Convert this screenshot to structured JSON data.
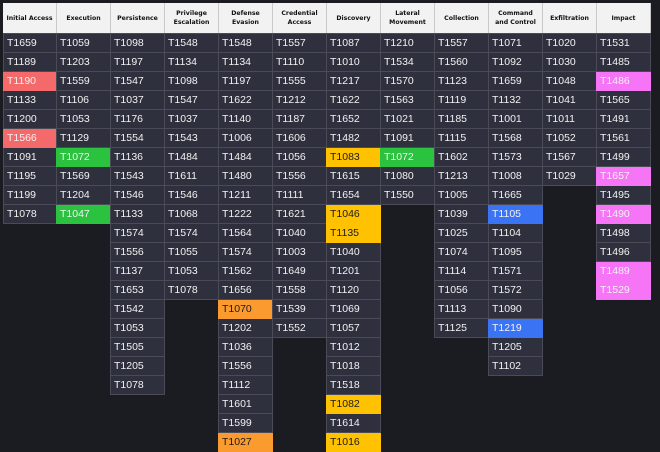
{
  "colors": {
    "red": "#f46a6a",
    "green": "#2ac23e",
    "orange": "#fb9a2e",
    "yellow": "#ffc200",
    "blue": "#3a74f5",
    "pink": "#f675f6"
  },
  "tactics": [
    {
      "name": "Initial Access",
      "techniques": [
        {
          "id": "T1659"
        },
        {
          "id": "T1189"
        },
        {
          "id": "T1190",
          "color": "red"
        },
        {
          "id": "T1133"
        },
        {
          "id": "T1200"
        },
        {
          "id": "T1566",
          "color": "red"
        },
        {
          "id": "T1091"
        },
        {
          "id": "T1195"
        },
        {
          "id": "T1199"
        },
        {
          "id": "T1078"
        }
      ]
    },
    {
      "name": "Execution",
      "techniques": [
        {
          "id": "T1059"
        },
        {
          "id": "T1203"
        },
        {
          "id": "T1559"
        },
        {
          "id": "T1106"
        },
        {
          "id": "T1053"
        },
        {
          "id": "T1129"
        },
        {
          "id": "T1072",
          "color": "green"
        },
        {
          "id": "T1569"
        },
        {
          "id": "T1204"
        },
        {
          "id": "T1047",
          "color": "green"
        }
      ]
    },
    {
      "name": "Persistence",
      "techniques": [
        {
          "id": "T1098"
        },
        {
          "id": "T1197"
        },
        {
          "id": "T1547"
        },
        {
          "id": "T1037"
        },
        {
          "id": "T1176"
        },
        {
          "id": "T1554"
        },
        {
          "id": "T1136"
        },
        {
          "id": "T1543"
        },
        {
          "id": "T1546"
        },
        {
          "id": "T1133"
        },
        {
          "id": "T1574"
        },
        {
          "id": "T1556"
        },
        {
          "id": "T1137"
        },
        {
          "id": "T1653"
        },
        {
          "id": "T1542"
        },
        {
          "id": "T1053"
        },
        {
          "id": "T1505"
        },
        {
          "id": "T1205"
        },
        {
          "id": "T1078"
        }
      ]
    },
    {
      "name": "Privilege Escalation",
      "techniques": [
        {
          "id": "T1548"
        },
        {
          "id": "T1134"
        },
        {
          "id": "T1098"
        },
        {
          "id": "T1547"
        },
        {
          "id": "T1037"
        },
        {
          "id": "T1543"
        },
        {
          "id": "T1484"
        },
        {
          "id": "T1611"
        },
        {
          "id": "T1546"
        },
        {
          "id": "T1068"
        },
        {
          "id": "T1574"
        },
        {
          "id": "T1055"
        },
        {
          "id": "T1053"
        },
        {
          "id": "T1078"
        }
      ]
    },
    {
      "name": "Defense Evasion",
      "techniques": [
        {
          "id": "T1548"
        },
        {
          "id": "T1134"
        },
        {
          "id": "T1197"
        },
        {
          "id": "T1622"
        },
        {
          "id": "T1140"
        },
        {
          "id": "T1006"
        },
        {
          "id": "T1484"
        },
        {
          "id": "T1480"
        },
        {
          "id": "T1211"
        },
        {
          "id": "T1222"
        },
        {
          "id": "T1564"
        },
        {
          "id": "T1574"
        },
        {
          "id": "T1562"
        },
        {
          "id": "T1656"
        },
        {
          "id": "T1070",
          "color": "orange"
        },
        {
          "id": "T1202"
        },
        {
          "id": "T1036"
        },
        {
          "id": "T1556"
        },
        {
          "id": "T1112"
        },
        {
          "id": "T1601"
        },
        {
          "id": "T1599"
        },
        {
          "id": "T1027",
          "color": "orange"
        }
      ]
    },
    {
      "name": "Credential Access",
      "techniques": [
        {
          "id": "T1557"
        },
        {
          "id": "T1110"
        },
        {
          "id": "T1555"
        },
        {
          "id": "T1212"
        },
        {
          "id": "T1187"
        },
        {
          "id": "T1606"
        },
        {
          "id": "T1056"
        },
        {
          "id": "T1556"
        },
        {
          "id": "T1111"
        },
        {
          "id": "T1621"
        },
        {
          "id": "T1040"
        },
        {
          "id": "T1003"
        },
        {
          "id": "T1649"
        },
        {
          "id": "T1558"
        },
        {
          "id": "T1539"
        },
        {
          "id": "T1552"
        }
      ]
    },
    {
      "name": "Discovery",
      "techniques": [
        {
          "id": "T1087"
        },
        {
          "id": "T1010"
        },
        {
          "id": "T1217"
        },
        {
          "id": "T1622"
        },
        {
          "id": "T1652"
        },
        {
          "id": "T1482"
        },
        {
          "id": "T1083",
          "color": "yellow"
        },
        {
          "id": "T1615"
        },
        {
          "id": "T1654"
        },
        {
          "id": "T1046",
          "color": "yellow"
        },
        {
          "id": "T1135",
          "color": "yellow"
        },
        {
          "id": "T1040"
        },
        {
          "id": "T1201"
        },
        {
          "id": "T1120"
        },
        {
          "id": "T1069"
        },
        {
          "id": "T1057"
        },
        {
          "id": "T1012"
        },
        {
          "id": "T1018"
        },
        {
          "id": "T1518"
        },
        {
          "id": "T1082",
          "color": "yellow"
        },
        {
          "id": "T1614"
        },
        {
          "id": "T1016",
          "color": "yellow"
        }
      ]
    },
    {
      "name": "Lateral Movement",
      "techniques": [
        {
          "id": "T1210"
        },
        {
          "id": "T1534"
        },
        {
          "id": "T1570"
        },
        {
          "id": "T1563"
        },
        {
          "id": "T1021"
        },
        {
          "id": "T1091"
        },
        {
          "id": "T1072",
          "color": "green"
        },
        {
          "id": "T1080"
        },
        {
          "id": "T1550"
        }
      ]
    },
    {
      "name": "Collection",
      "techniques": [
        {
          "id": "T1557"
        },
        {
          "id": "T1560"
        },
        {
          "id": "T1123"
        },
        {
          "id": "T1119"
        },
        {
          "id": "T1185"
        },
        {
          "id": "T1115"
        },
        {
          "id": "T1602"
        },
        {
          "id": "T1213"
        },
        {
          "id": "T1005"
        },
        {
          "id": "T1039"
        },
        {
          "id": "T1025"
        },
        {
          "id": "T1074"
        },
        {
          "id": "T1114"
        },
        {
          "id": "T1056"
        },
        {
          "id": "T1113"
        },
        {
          "id": "T1125"
        }
      ]
    },
    {
      "name": "Command and Control",
      "techniques": [
        {
          "id": "T1071"
        },
        {
          "id": "T1092"
        },
        {
          "id": "T1659"
        },
        {
          "id": "T1132"
        },
        {
          "id": "T1001"
        },
        {
          "id": "T1568"
        },
        {
          "id": "T1573"
        },
        {
          "id": "T1008"
        },
        {
          "id": "T1665"
        },
        {
          "id": "T1105",
          "color": "blue"
        },
        {
          "id": "T1104"
        },
        {
          "id": "T1095"
        },
        {
          "id": "T1571"
        },
        {
          "id": "T1572"
        },
        {
          "id": "T1090"
        },
        {
          "id": "T1219",
          "color": "blue"
        },
        {
          "id": "T1205"
        },
        {
          "id": "T1102"
        }
      ]
    },
    {
      "name": "Exfiltration",
      "techniques": [
        {
          "id": "T1020"
        },
        {
          "id": "T1030"
        },
        {
          "id": "T1048"
        },
        {
          "id": "T1041"
        },
        {
          "id": "T1011"
        },
        {
          "id": "T1052"
        },
        {
          "id": "T1567"
        },
        {
          "id": "T1029"
        }
      ]
    },
    {
      "name": "Impact",
      "techniques": [
        {
          "id": "T1531"
        },
        {
          "id": "T1485"
        },
        {
          "id": "T1486",
          "color": "pink"
        },
        {
          "id": "T1565"
        },
        {
          "id": "T1491"
        },
        {
          "id": "T1561"
        },
        {
          "id": "T1499"
        },
        {
          "id": "T1657",
          "color": "pink"
        },
        {
          "id": "T1495"
        },
        {
          "id": "T1490",
          "color": "pink"
        },
        {
          "id": "T1498"
        },
        {
          "id": "T1496"
        },
        {
          "id": "T1489",
          "color": "pink"
        },
        {
          "id": "T1529",
          "color": "pink"
        }
      ]
    }
  ]
}
